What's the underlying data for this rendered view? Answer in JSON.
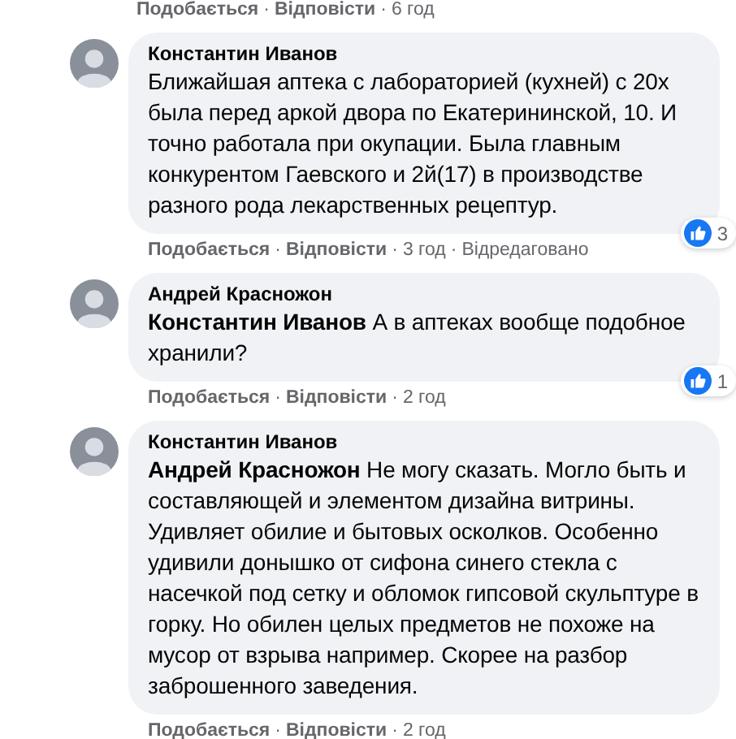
{
  "separator": "·",
  "previous_actions": {
    "like": "Подобається",
    "reply": "Відповісти",
    "time": "6 год"
  },
  "comments": [
    {
      "author": "Константин Иванов",
      "text": "Ближайшая аптека с лабораторией (кухней) с 20х была перед аркой двора по Екатерининской, 10. И точно работала при окупации. Была главным конкурентом Гаевского и 2й(17) в производстве разного рода лекарственных рецептур.",
      "reactions": "3",
      "actions": {
        "like": "Подобається",
        "reply": "Відповісти",
        "time": "3 год",
        "edited": "Відредаговано"
      }
    },
    {
      "author": "Андрей Красножон",
      "text": "**Константин Иванов** А в аптеках вообще подобное хранили?",
      "reactions": "1",
      "actions": {
        "like": "Подобається",
        "reply": "Відповісти",
        "time": "2 год"
      }
    },
    {
      "author": "Константин Иванов",
      "text": "**Андрей Красножон** Не могу сказать. Могло быть и составляющей и элементом дизайна витрины. Удивляет обилие и бытовых осколков. Особенно удивили донышко от сифона синего стекла с насечкой под сетку и обломок гипсовой скульптуре в горку. Но обилен целых предметов не похоже на мусор от взрыва например. Скорее на разбор заброшенного заведения.",
      "actions": {
        "like": "Подобається",
        "reply": "Відповісти",
        "time": "2 год"
      }
    }
  ]
}
